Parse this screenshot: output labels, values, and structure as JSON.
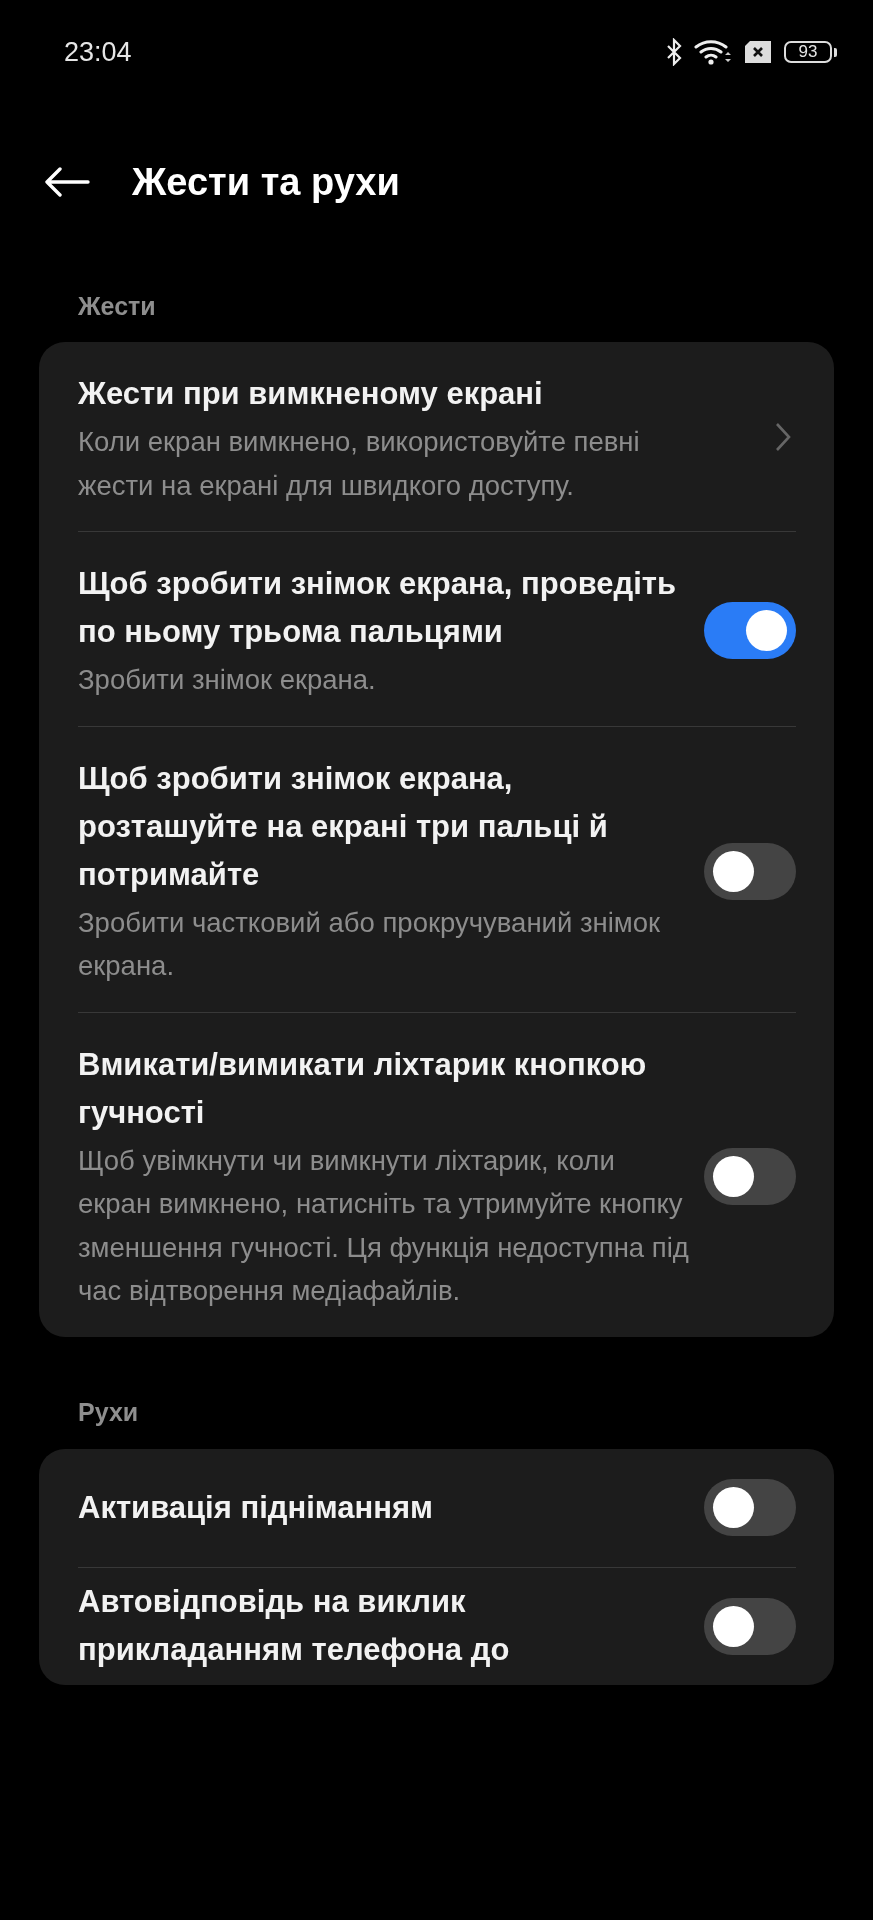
{
  "status_bar": {
    "time": "23:04",
    "battery": "93"
  },
  "header": {
    "title": "Жести та рухи"
  },
  "sections": [
    {
      "title": "Жести",
      "rows": [
        {
          "kind": "link",
          "title": "Жести при вимкненому екрані",
          "subtitle": "Коли екран вимкнено, використовуйте певні жести на екрані для швидкого доступу."
        },
        {
          "kind": "toggle",
          "title": "Щоб зробити знімок екрана, проведіть по ньому трьома пальцями",
          "subtitle": "Зробити знімок екрана.",
          "on": true
        },
        {
          "kind": "toggle",
          "title": "Щоб зробити знімок екрана, розташуйте на екрані три пальці й потримайте",
          "subtitle": "Зробити частковий або прокручуваний знімок екрана.",
          "on": false
        },
        {
          "kind": "toggle",
          "title": "Вмикати/вимикати ліхтарик кнопкою гучності",
          "subtitle": "Щоб увімкнути чи вимкнути ліхтарик, коли екран вимкнено, натисніть та утримуйте кнопку зменшення гучності. Ця функція недоступна під час відтворення медіафайлів.",
          "on": false
        }
      ]
    },
    {
      "title": "Рухи",
      "rows": [
        {
          "kind": "toggle",
          "title": "Активація підніманням",
          "on": false
        },
        {
          "kind": "toggle",
          "title": "Автовідповідь на виклик прикладанням телефона до",
          "on": false
        }
      ]
    }
  ]
}
